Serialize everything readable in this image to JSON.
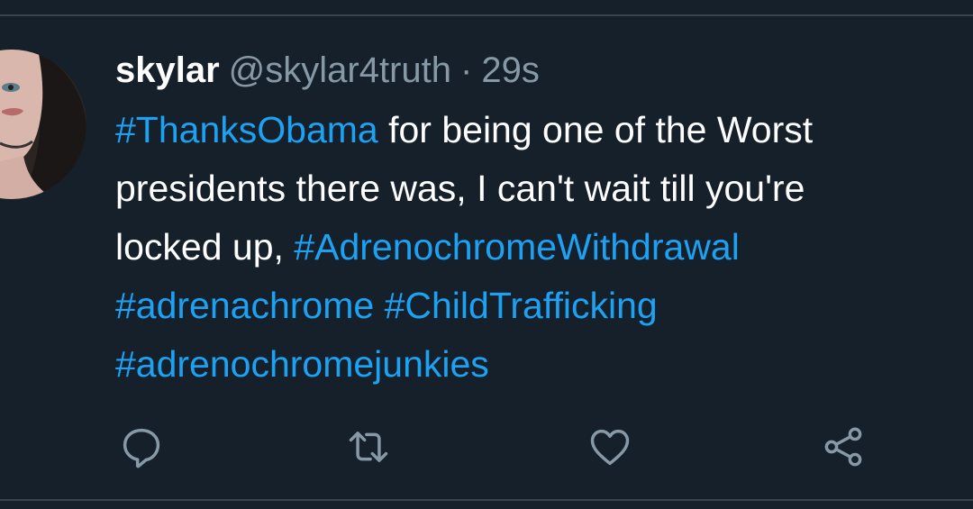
{
  "tweet": {
    "author": {
      "display_name": "skylar",
      "handle": "@skylar4truth"
    },
    "separator": "·",
    "timestamp": "29s",
    "body_lines": [
      [
        {
          "type": "hashtag",
          "text": "#ThanksObama"
        },
        {
          "type": "text",
          "text": " for being one of the Worst"
        }
      ],
      [
        {
          "type": "text",
          "text": "presidents there was, I can't wait till you're"
        }
      ],
      [
        {
          "type": "text",
          "text": "locked up, "
        },
        {
          "type": "hashtag",
          "text": "#AdrenochromeWithdrawal"
        }
      ],
      [
        {
          "type": "hashtag",
          "text": "#adrenachrome"
        },
        {
          "type": "text",
          "text": " "
        },
        {
          "type": "hashtag",
          "text": "#ChildTrafficking"
        }
      ],
      [
        {
          "type": "hashtag",
          "text": "#adrenochromejunkies"
        }
      ]
    ]
  },
  "actions": [
    {
      "name": "reply",
      "icon": "reply-icon"
    },
    {
      "name": "retweet",
      "icon": "retweet-icon"
    },
    {
      "name": "like",
      "icon": "heart-icon"
    },
    {
      "name": "share",
      "icon": "share-icon"
    }
  ],
  "colors": {
    "background": "#15202b",
    "text": "#ffffff",
    "secondary_text": "#8899a6",
    "hashtag": "#1da1f2",
    "icon": "#8899a6",
    "divider": "#38444d"
  }
}
